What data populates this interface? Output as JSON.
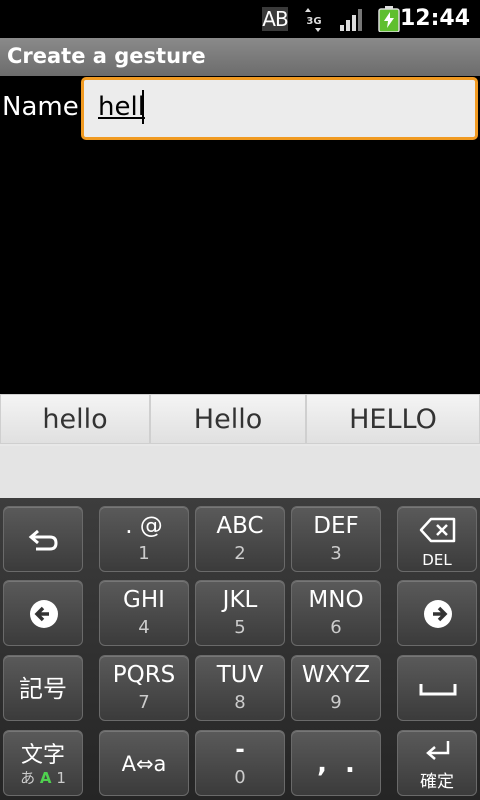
{
  "status_bar": {
    "ime_indicator": "AB",
    "network": "3G",
    "time": "12:44",
    "icons": [
      "ime-ab-icon",
      "network-3g-icon",
      "signal-icon",
      "battery-charging-icon"
    ]
  },
  "title_bar": {
    "title": "Create a gesture"
  },
  "form": {
    "name_label": "Name",
    "name_value": "hell"
  },
  "candidates": [
    "hello",
    "Hello",
    "HELLO"
  ],
  "keyboard": {
    "rows": [
      [
        {
          "id": "undo",
          "icon": "undo-icon"
        },
        {
          "id": "k1",
          "main": ". @",
          "sub": "1"
        },
        {
          "id": "k2",
          "main": "ABC",
          "sub": "2"
        },
        {
          "id": "k3",
          "main": "DEF",
          "sub": "3"
        },
        {
          "id": "del",
          "icon": "backspace-icon",
          "label": "DEL"
        }
      ],
      [
        {
          "id": "left",
          "icon": "arrow-left-icon"
        },
        {
          "id": "k4",
          "main": "GHI",
          "sub": "4"
        },
        {
          "id": "k5",
          "main": "JKL",
          "sub": "5"
        },
        {
          "id": "k6",
          "main": "MNO",
          "sub": "6"
        },
        {
          "id": "right",
          "icon": "arrow-right-icon"
        }
      ],
      [
        {
          "id": "symbol",
          "main": "記号"
        },
        {
          "id": "k7",
          "main": "PQRS",
          "sub": "7"
        },
        {
          "id": "k8",
          "main": "TUV",
          "sub": "8"
        },
        {
          "id": "k9",
          "main": "WXYZ",
          "sub": "9"
        },
        {
          "id": "space",
          "icon": "space-icon"
        }
      ],
      [
        {
          "id": "mode",
          "main": "文字",
          "sub_parts": [
            "あ",
            "A",
            "1"
          ]
        },
        {
          "id": "case",
          "main": "A⇔a"
        },
        {
          "id": "k0",
          "main": "-",
          "sub": "0"
        },
        {
          "id": "punct",
          "main": ",  ."
        },
        {
          "id": "enter",
          "icon": "enter-icon",
          "label": "確定"
        }
      ]
    ]
  },
  "colors": {
    "input_border": "#f09a22",
    "title_bar": "#7a7a7a",
    "mode_active": "#4fd14f"
  }
}
